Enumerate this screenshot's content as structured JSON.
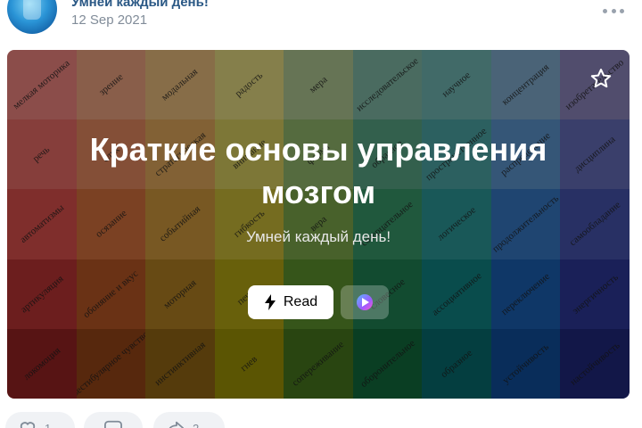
{
  "post": {
    "author": "Умней каждый день!",
    "date": "12 Sep 2021"
  },
  "article": {
    "title_line1": "Краткие основы управления",
    "title_line2": "мозгом",
    "subtitle": "Умней каждый день!",
    "read_label": "Read",
    "listen_icon": "play-icon",
    "bookmark_icon": "star-icon"
  },
  "grid_colors": [
    [
      "#c86f6b",
      "#c5876a",
      "#c29c67",
      "#bfb66c",
      "#93a67a",
      "#6a9a8a",
      "#5d9896",
      "#6b8fab",
      "#756f9c"
    ],
    [
      "#c15a55",
      "#bd724f",
      "#ba8c4d",
      "#b4ab4f",
      "#7a9a5b",
      "#4a8a6f",
      "#3f8a8a",
      "#4c7bab",
      "#545b9a"
    ],
    [
      "#b6433f",
      "#b05e33",
      "#ad7e33",
      "#a89b2f",
      "#678c3e",
      "#2f7e58",
      "#257f7f",
      "#2d63a3",
      "#3a4690"
    ],
    [
      "#9b2c2b",
      "#99481f",
      "#946a1e",
      "#968a10",
      "#4e7a26",
      "#1a6c45",
      "#0d6d6e",
      "#164f94",
      "#262f7e"
    ],
    [
      "#7d1d1d",
      "#7d3a14",
      "#7a5512",
      "#837a05",
      "#3b6419",
      "#0f5933",
      "#065a5c",
      "#0d4181",
      "#1a2168"
    ]
  ],
  "grid_words": [
    [
      "мелкая моторика",
      "зрение",
      "модальная",
      "радость",
      "мера",
      "исследовательское",
      "научное",
      "концентрация",
      "изобретательство"
    ],
    [
      "речь",
      "слух",
      "стратегическая",
      "внимание",
      "форма",
      "образное",
      "пространственное",
      "распределение",
      "дисциплина"
    ],
    [
      "автоматизмы",
      "осязание",
      "событийная",
      "гибкость",
      "вера",
      "созерцательное",
      "логическое",
      "продолжительность",
      "самообладание"
    ],
    [
      "артикуляция",
      "обоняние и вкус",
      "моторная",
      "печаль",
      "ритм",
      "словесное",
      "ассоциативное",
      "переключение",
      "энергичность"
    ],
    [
      "локомоция",
      "вестибулярное чувство",
      "инстинктивная",
      "гнев",
      "сопереживание",
      "оборонительное",
      "образное",
      "устойчивость",
      "настойчивость"
    ]
  ],
  "actions": {
    "like_icon": "heart-icon",
    "like_count": "1",
    "comment_icon": "comment-icon",
    "share_icon": "share-icon",
    "share_count": "2"
  }
}
